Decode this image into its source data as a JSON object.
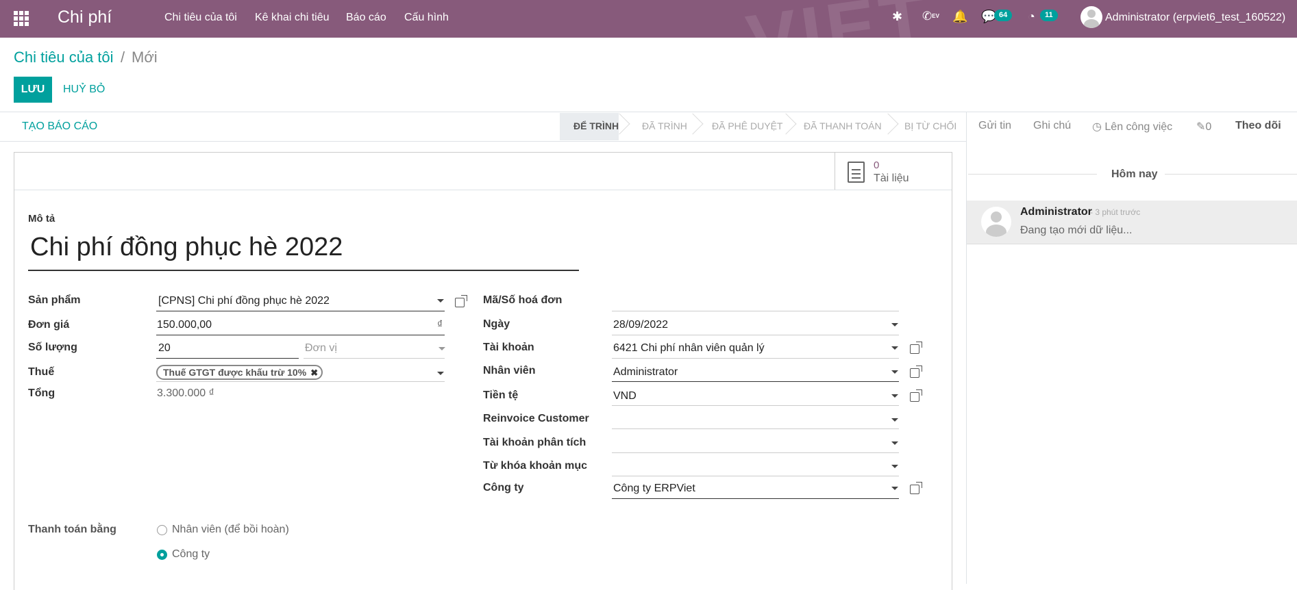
{
  "topbar": {
    "app_title": "Chi phí",
    "menu": [
      "Chi tiêu của tôi",
      "Kê khai chi tiêu",
      "Báo cáo",
      "Cấu hình"
    ],
    "messages_count": "64",
    "activities_count": "11",
    "user": "Administrator (erpviet6_test_160522)",
    "watermark": "VIET",
    "ev_badge": "EV"
  },
  "breadcrumb": {
    "parent": "Chi tiêu của tôi",
    "separator": "/",
    "current": "Mới"
  },
  "actions": {
    "save": "LƯU",
    "discard": "HUỶ BỎ"
  },
  "statusbar": {
    "create_report": "TẠO BÁO CÁO",
    "stages": [
      "ĐỂ TRÌNH",
      "ĐÃ TRÌNH",
      "ĐÃ PHÊ DUYỆT",
      "ĐÃ THANH TOÁN",
      "BỊ TỪ CHỐI"
    ],
    "active_stage": "ĐỂ TRÌNH"
  },
  "doc_button": {
    "count": "0",
    "label": "Tài liệu"
  },
  "form": {
    "description_label": "Mô tả",
    "description": "Chi phí đồng phục hè 2022",
    "left": {
      "product_label": "Sản phẩm",
      "product": "[CPNS] Chi phí đồng phục hè 2022",
      "unit_price_label": "Đơn giá",
      "unit_price": "150.000,00",
      "currency_symbol": "₫",
      "qty_label": "Số lượng",
      "qty": "20",
      "uom_placeholder": "Đơn vị",
      "tax_label": "Thuế",
      "tax_tag": "Thuế GTGT được khấu trừ 10%",
      "total_label": "Tổng",
      "total": "3.300.000 ₫"
    },
    "right": {
      "invoice_label": "Mã/Số hoá đơn",
      "invoice": "",
      "date_label": "Ngày",
      "date": "28/09/2022",
      "account_label": "Tài khoản",
      "account": "6421 Chi phí nhân viên quản lý",
      "employee_label": "Nhân viên",
      "employee": "Administrator",
      "currency_label": "Tiền tệ",
      "currency": "VND",
      "reinvoice_label": "Reinvoice Customer",
      "reinvoice": "",
      "analytic_label": "Tài khoản phân tích",
      "analytic": "",
      "tags_label": "Từ khóa khoản mục",
      "tags": "",
      "company_label": "Công ty",
      "company": "Công ty ERPViet"
    },
    "payment_label": "Thanh toán bằng",
    "payment_options": [
      "Nhân viên (để bồi hoàn)",
      "Công ty"
    ],
    "payment_selected": "Công ty"
  },
  "chatter": {
    "send_message": "Gửi tin",
    "log_note": "Ghi chú",
    "schedule_activity": "Lên công việc",
    "attachments": "0",
    "follow": "Theo dõi",
    "today": "Hôm nay",
    "message": {
      "author": "Administrator",
      "time": "- 3 phút trước",
      "body": "Đang tạo mới dữ liệu..."
    }
  }
}
